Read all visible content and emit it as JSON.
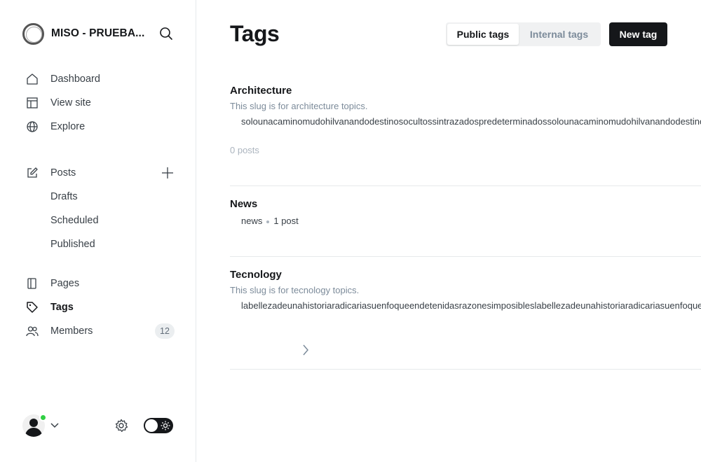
{
  "brand": {
    "name": "MISO - PRUEBA..."
  },
  "sidebar": {
    "primary": [
      {
        "label": "Dashboard",
        "icon": "home-icon"
      },
      {
        "label": "View site",
        "icon": "layout-icon"
      },
      {
        "label": "Explore",
        "icon": "globe-icon"
      }
    ],
    "posts": {
      "label": "Posts",
      "sub": [
        "Drafts",
        "Scheduled",
        "Published"
      ]
    },
    "secondary": [
      {
        "label": "Pages",
        "icon": "page-icon"
      },
      {
        "label": "Tags",
        "icon": "tag-icon",
        "active": true
      },
      {
        "label": "Members",
        "icon": "members-icon",
        "count": "12"
      }
    ]
  },
  "main": {
    "title": "Tags",
    "tabs": {
      "public": "Public tags",
      "internal": "Internal tags"
    },
    "new_tag_label": "New tag",
    "tags": [
      {
        "name": "Architecture",
        "description": "This slug is for architecture topics.",
        "slug": "solounacaminomudohilvanandodestinosocultossintrazadospredeterminadossolounacaminomudohilvanandodestinosocultos",
        "count": "0 posts"
      },
      {
        "name": "News",
        "slug": "news",
        "count": "1 post"
      },
      {
        "name": "Tecnology",
        "description": "This slug is for tecnology topics.",
        "slug": "labellezadeunahistoriaradicariasuenfoqueendetenidasrazonesimposibleslabellezadeunahistoriaradicariasuenfoque"
      }
    ]
  },
  "colors": {
    "accent": "#15171a",
    "online": "#30cf43",
    "muted": "#7c8b9a"
  }
}
